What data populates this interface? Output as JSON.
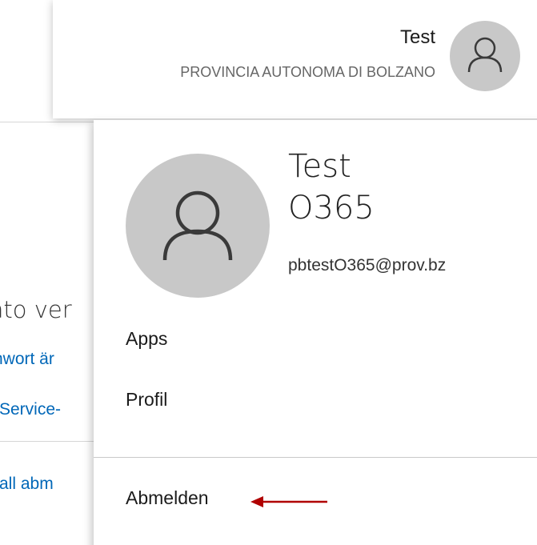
{
  "background": {
    "heading": "nto ver",
    "links": [
      "nwort är",
      "-Service-",
      "rall abm"
    ]
  },
  "header": {
    "display_name": "Test",
    "organization": "PROVINCIA AUTONOMA DI BOLZANO",
    "avatar_icon": "person-icon"
  },
  "flyout": {
    "name": "Test\nO365",
    "email": "pbtestO365@prov.bz",
    "menu": {
      "apps": "Apps",
      "profile": "Profil",
      "sign_out": "Abmelden"
    },
    "annotation_arrow_color": "#b00000"
  },
  "colors": {
    "link": "#0067b8",
    "avatar_bg": "#c8c8c8"
  }
}
